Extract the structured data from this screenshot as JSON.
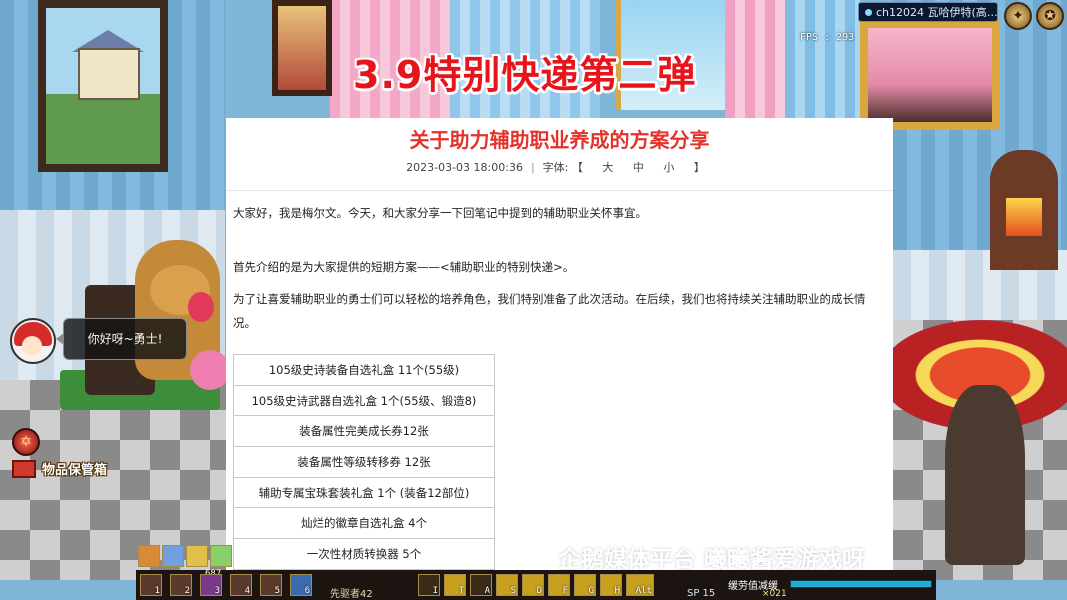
{
  "banner": {
    "title": "3.9特别快递第二弹"
  },
  "hud_top": {
    "fps": "FPS : 293",
    "channel": "ch12024 瓦哈伊特(高…"
  },
  "npc": {
    "speech": "你好呀~勇士!"
  },
  "storage": {
    "label": "物品保管箱"
  },
  "article": {
    "title": "关于助力辅助职业养成的方案分享",
    "datetime": "2023-03-03 18:00:36",
    "font_label": "字体:",
    "font_options": "【 大 中 小 】",
    "paragraphs": [
      "大家好，我是梅尔文。今天，和大家分享一下回笔记中提到的辅助职业关怀事宜。",
      "首先介绍的是为大家提供的短期方案——<辅助职业的特别快递>。",
      "为了让喜爱辅助职业的勇士们可以轻松的培养角色，我们特别准备了此次活动。在后续，我们也将持续关注辅助职业的成长情况。"
    ],
    "items": [
      "105级史诗装备自选礼盒 11个(55级)",
      "105级史诗武器自选礼盒 1个(55级、锻造8)",
      "装备属性完美成长券12张",
      "装备属性等级转移券 12张",
      "辅助专属宝珠套装礼盒 1个 (装备12部位)",
      "灿烂的徽章自选礼盒 4个",
      "一次性材质转换器 5个"
    ]
  },
  "watermark": "企鹅媒体平台 曦曦酱爱游戏呀",
  "hud_bottom": {
    "number": "687",
    "character_name": "先驱者42",
    "sp": "SP 15",
    "status": "缓劳值减缓",
    "count": "×021",
    "slot_keys": [
      "1",
      "2",
      "3",
      "4",
      "5",
      "6"
    ],
    "hotkeys": [
      "I",
      "T",
      "A",
      "S",
      "D",
      "F",
      "G",
      "H",
      "Alt"
    ]
  },
  "colors": {
    "title_red": "#e3332b",
    "banner_red": "#e8141c",
    "panel_bg": "#ffffff",
    "text": "#222222"
  }
}
